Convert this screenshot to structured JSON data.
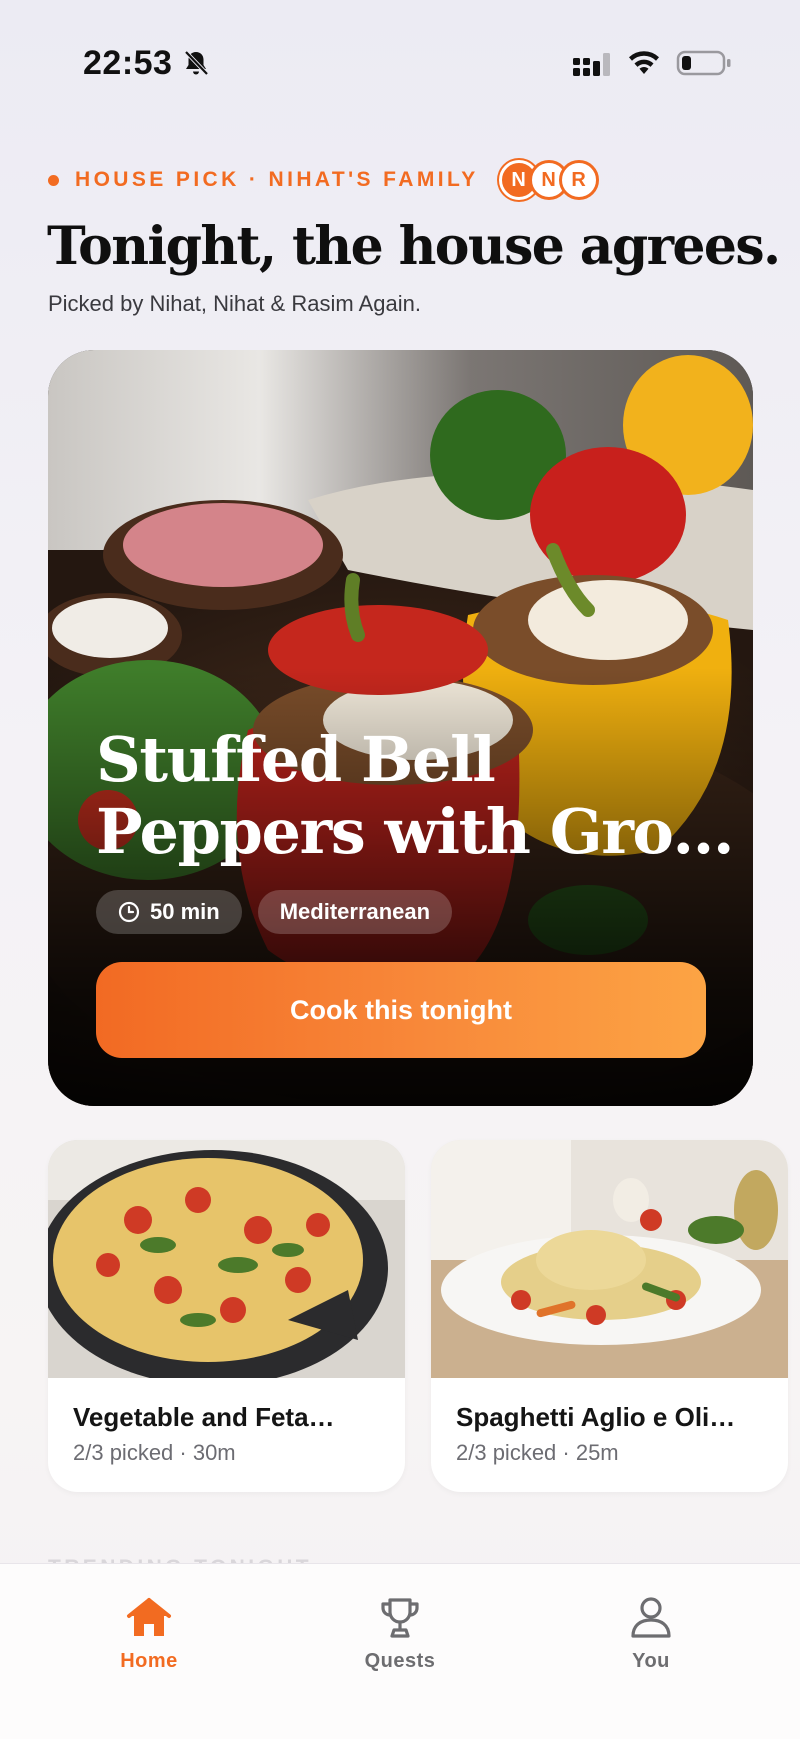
{
  "status_bar": {
    "time": "22:53",
    "icons": [
      "bell-slash-icon",
      "cellular-signal-icon",
      "wifi-icon",
      "battery-icon"
    ]
  },
  "header": {
    "pick_label": "HOUSE PICK · NIHAT'S FAMILY",
    "avatars": [
      "N",
      "N",
      "R"
    ],
    "headline": "Tonight, the house agrees.",
    "subline": "Picked by Nihat, Nihat & Rasim Again."
  },
  "hero": {
    "title": "Stuffed Bell Peppers with Gro…",
    "time_chip": "50 min",
    "cuisine_chip": "Mediterranean",
    "cta_label": "Cook this tonight"
  },
  "recipes": [
    {
      "title": "Vegetable and Feta…",
      "meta": "2/3 picked · 30m"
    },
    {
      "title": "Spaghetti Aglio e Oli…",
      "meta": "2/3 picked · 25m"
    }
  ],
  "section_peek": "TRENDING TONIGHT",
  "nav": {
    "items": [
      {
        "label": "Home",
        "icon": "home-icon",
        "active": true
      },
      {
        "label": "Quests",
        "icon": "trophy-icon",
        "active": false
      },
      {
        "label": "You",
        "icon": "person-icon",
        "active": false
      }
    ]
  },
  "colors": {
    "accent": "#f26b21",
    "accent_gradient_end": "#fca444",
    "nav_inactive": "#6d6d70"
  }
}
